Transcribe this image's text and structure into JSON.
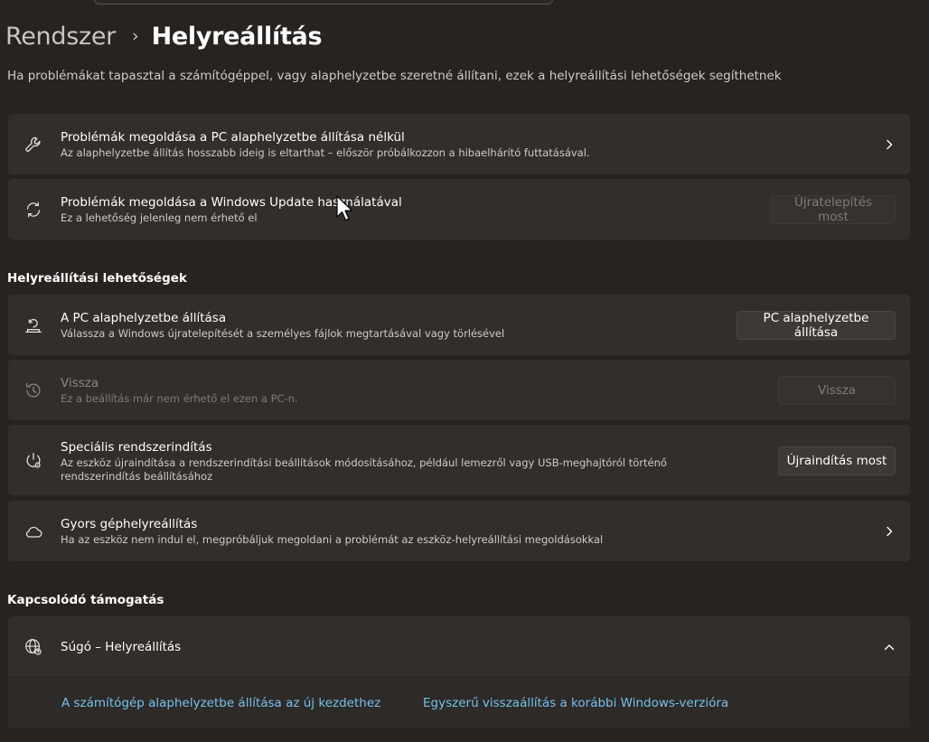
{
  "breadcrumb": {
    "parent": "Rendszer",
    "separator": "›",
    "current": "Helyreállítás"
  },
  "intro": "Ha problémákat tapasztal a számítógéppel, vagy alaphelyzetbe szeretné állítani, ezek a helyreállítási lehetőségek segíthetnek",
  "troubleshoot": {
    "title": "Problémák megoldása a PC alaphelyzetbe állítása nélkül",
    "desc": "Az alaphelyzetbe állítás hosszabb ideig is eltarthat – először próbálkozzon a hibaelhárító futtatásával."
  },
  "windows_update": {
    "title": "Problémák megoldása a Windows Update használatával",
    "desc": "Ez a lehetőség jelenleg nem érhető el",
    "button": "Újratelepítés most"
  },
  "recovery_section": {
    "title": "Helyreállítási lehetőségek",
    "reset": {
      "title": "A PC alaphelyzetbe állítása",
      "desc": "Válassza a Windows újratelepítését a személyes fájlok megtartásával vagy törlésével",
      "button": "PC alaphelyzetbe állítása"
    },
    "go_back": {
      "title": "Vissza",
      "desc": "Ez a beállítás már nem érhető el ezen a PC-n.",
      "button": "Vissza"
    },
    "advanced_startup": {
      "title": "Speciális rendszerindítás",
      "desc": "Az eszköz újraindítása a rendszerindítási beállítások módosításához, például lemezről vagy USB-meghajtóról történő rendszerindítás beállításához",
      "button": "Újraindítás most"
    },
    "quick_recovery": {
      "title": "Gyors géphelyreállítás",
      "desc": "Ha az eszköz nem indul el, megpróbáljuk megoldani a problémát az eszköz-helyreállítási megoldásokkal"
    }
  },
  "support_section": {
    "title": "Kapcsolódó támogatás",
    "help": {
      "title": "Súgó – Helyreállítás",
      "links": [
        "A számítógép alaphelyzetbe állítása az új kezdethez",
        "Egyszerű visszaállítás a korábbi Windows-verzióra"
      ]
    }
  },
  "colors": {
    "background": "#272320",
    "card": "#322e2b",
    "link": "#75c1ef"
  },
  "icons": [
    "wrench-icon",
    "sync-icon",
    "reset-pc-icon",
    "history-icon",
    "power-settings-icon",
    "cloud-icon",
    "globe-help-icon",
    "chevron-right-icon",
    "chevron-up-icon"
  ]
}
